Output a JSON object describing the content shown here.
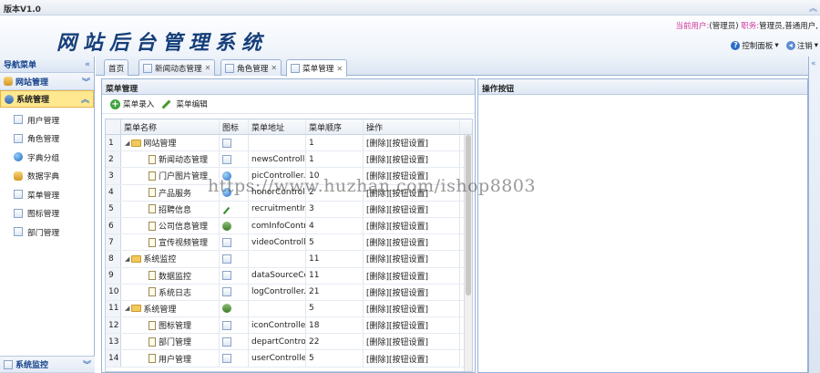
{
  "app": {
    "version": "版本V1.0",
    "title": "网站后台管理系统"
  },
  "user": {
    "label_current": "当前用户:",
    "current": "(管理员)",
    "label_role": "职务:",
    "roles": "管理员,普通用户,"
  },
  "header_tools": {
    "control_panel": "控制面板",
    "logout": "注销"
  },
  "nav": {
    "title": "导航菜单",
    "groups": [
      {
        "label": "网站管理",
        "active": false
      },
      {
        "label": "系统管理",
        "active": true
      }
    ],
    "items": [
      {
        "label": "用户管理",
        "icon": "page-icon"
      },
      {
        "label": "角色管理",
        "icon": "page-icon"
      },
      {
        "label": "字典分组",
        "icon": "globe-icon"
      },
      {
        "label": "数据字典",
        "icon": "database-icon"
      },
      {
        "label": "菜单管理",
        "icon": "page-icon"
      },
      {
        "label": "图标管理",
        "icon": "page-icon"
      },
      {
        "label": "部门管理",
        "icon": "page-icon"
      }
    ],
    "bottom_group": "系统监控"
  },
  "tabs": [
    {
      "label": "首页",
      "closable": false
    },
    {
      "label": "新闻动态管理",
      "closable": true
    },
    {
      "label": "角色管理",
      "closable": true
    },
    {
      "label": "菜单管理",
      "closable": true,
      "selected": true
    }
  ],
  "menu_panel": {
    "title": "菜单管理",
    "add_button": "菜单录入",
    "edit_button": "菜单编辑",
    "columns": [
      "菜单名称",
      "图标",
      "菜单地址",
      "菜单顺序",
      "操作"
    ],
    "rows": [
      {
        "n": "1",
        "name": "网站管理",
        "type": "folder",
        "icon": "page",
        "url": "",
        "order": "1",
        "ops": "[删除][按钮设置]"
      },
      {
        "n": "2",
        "name": "新闻动态管理",
        "type": "leaf",
        "icon": "page",
        "url": "newsController",
        "order": "1",
        "ops": "[删除][按钮设置]"
      },
      {
        "n": "3",
        "name": "门户图片管理",
        "type": "leaf",
        "icon": "globe",
        "url": "picController.do",
        "order": "10",
        "ops": "[删除][按钮设置]"
      },
      {
        "n": "4",
        "name": "产品服务",
        "type": "leaf",
        "icon": "globe",
        "url": "honorController",
        "order": "2",
        "ops": "[删除][按钮设置]"
      },
      {
        "n": "5",
        "name": "招聘信息",
        "type": "leaf",
        "icon": "pencil",
        "url": "recruitmentInfo",
        "order": "3",
        "ops": "[删除][按钮设置]"
      },
      {
        "n": "6",
        "name": "公司信息管理",
        "type": "leaf",
        "icon": "users",
        "url": "comInfoControl",
        "order": "4",
        "ops": "[删除][按钮设置]"
      },
      {
        "n": "7",
        "name": "宣传视频管理",
        "type": "leaf",
        "icon": "page",
        "url": "videoController",
        "order": "5",
        "ops": "[删除][按钮设置]"
      },
      {
        "n": "8",
        "name": "系统监控",
        "type": "folder",
        "icon": "page",
        "url": "",
        "order": "11",
        "ops": "[删除][按钮设置]"
      },
      {
        "n": "9",
        "name": "数据监控",
        "type": "leaf",
        "icon": "page",
        "url": "dataSourceCon",
        "order": "11",
        "ops": "[删除][按钮设置]"
      },
      {
        "n": "10",
        "name": "系统日志",
        "type": "leaf",
        "icon": "page",
        "url": "logController.dc",
        "order": "21",
        "ops": "[删除][按钮设置]"
      },
      {
        "n": "11",
        "name": "系统管理",
        "type": "folder",
        "icon": "users",
        "url": "",
        "order": "5",
        "ops": "[删除][按钮设置]"
      },
      {
        "n": "12",
        "name": "图标管理",
        "type": "leaf",
        "icon": "page",
        "url": "iconController.c",
        "order": "18",
        "ops": "[删除][按钮设置]"
      },
      {
        "n": "13",
        "name": "部门管理",
        "type": "leaf",
        "icon": "page",
        "url": "departControlle",
        "order": "22",
        "ops": "[删除][按钮设置]"
      },
      {
        "n": "14",
        "name": "用户管理",
        "type": "leaf",
        "icon": "page",
        "url": "userController.c",
        "order": "5",
        "ops": "[删除][按钮设置]"
      }
    ]
  },
  "button_panel": {
    "title": "操作按钮"
  },
  "watermark": "https://www.huzhan.com/ishop8803"
}
